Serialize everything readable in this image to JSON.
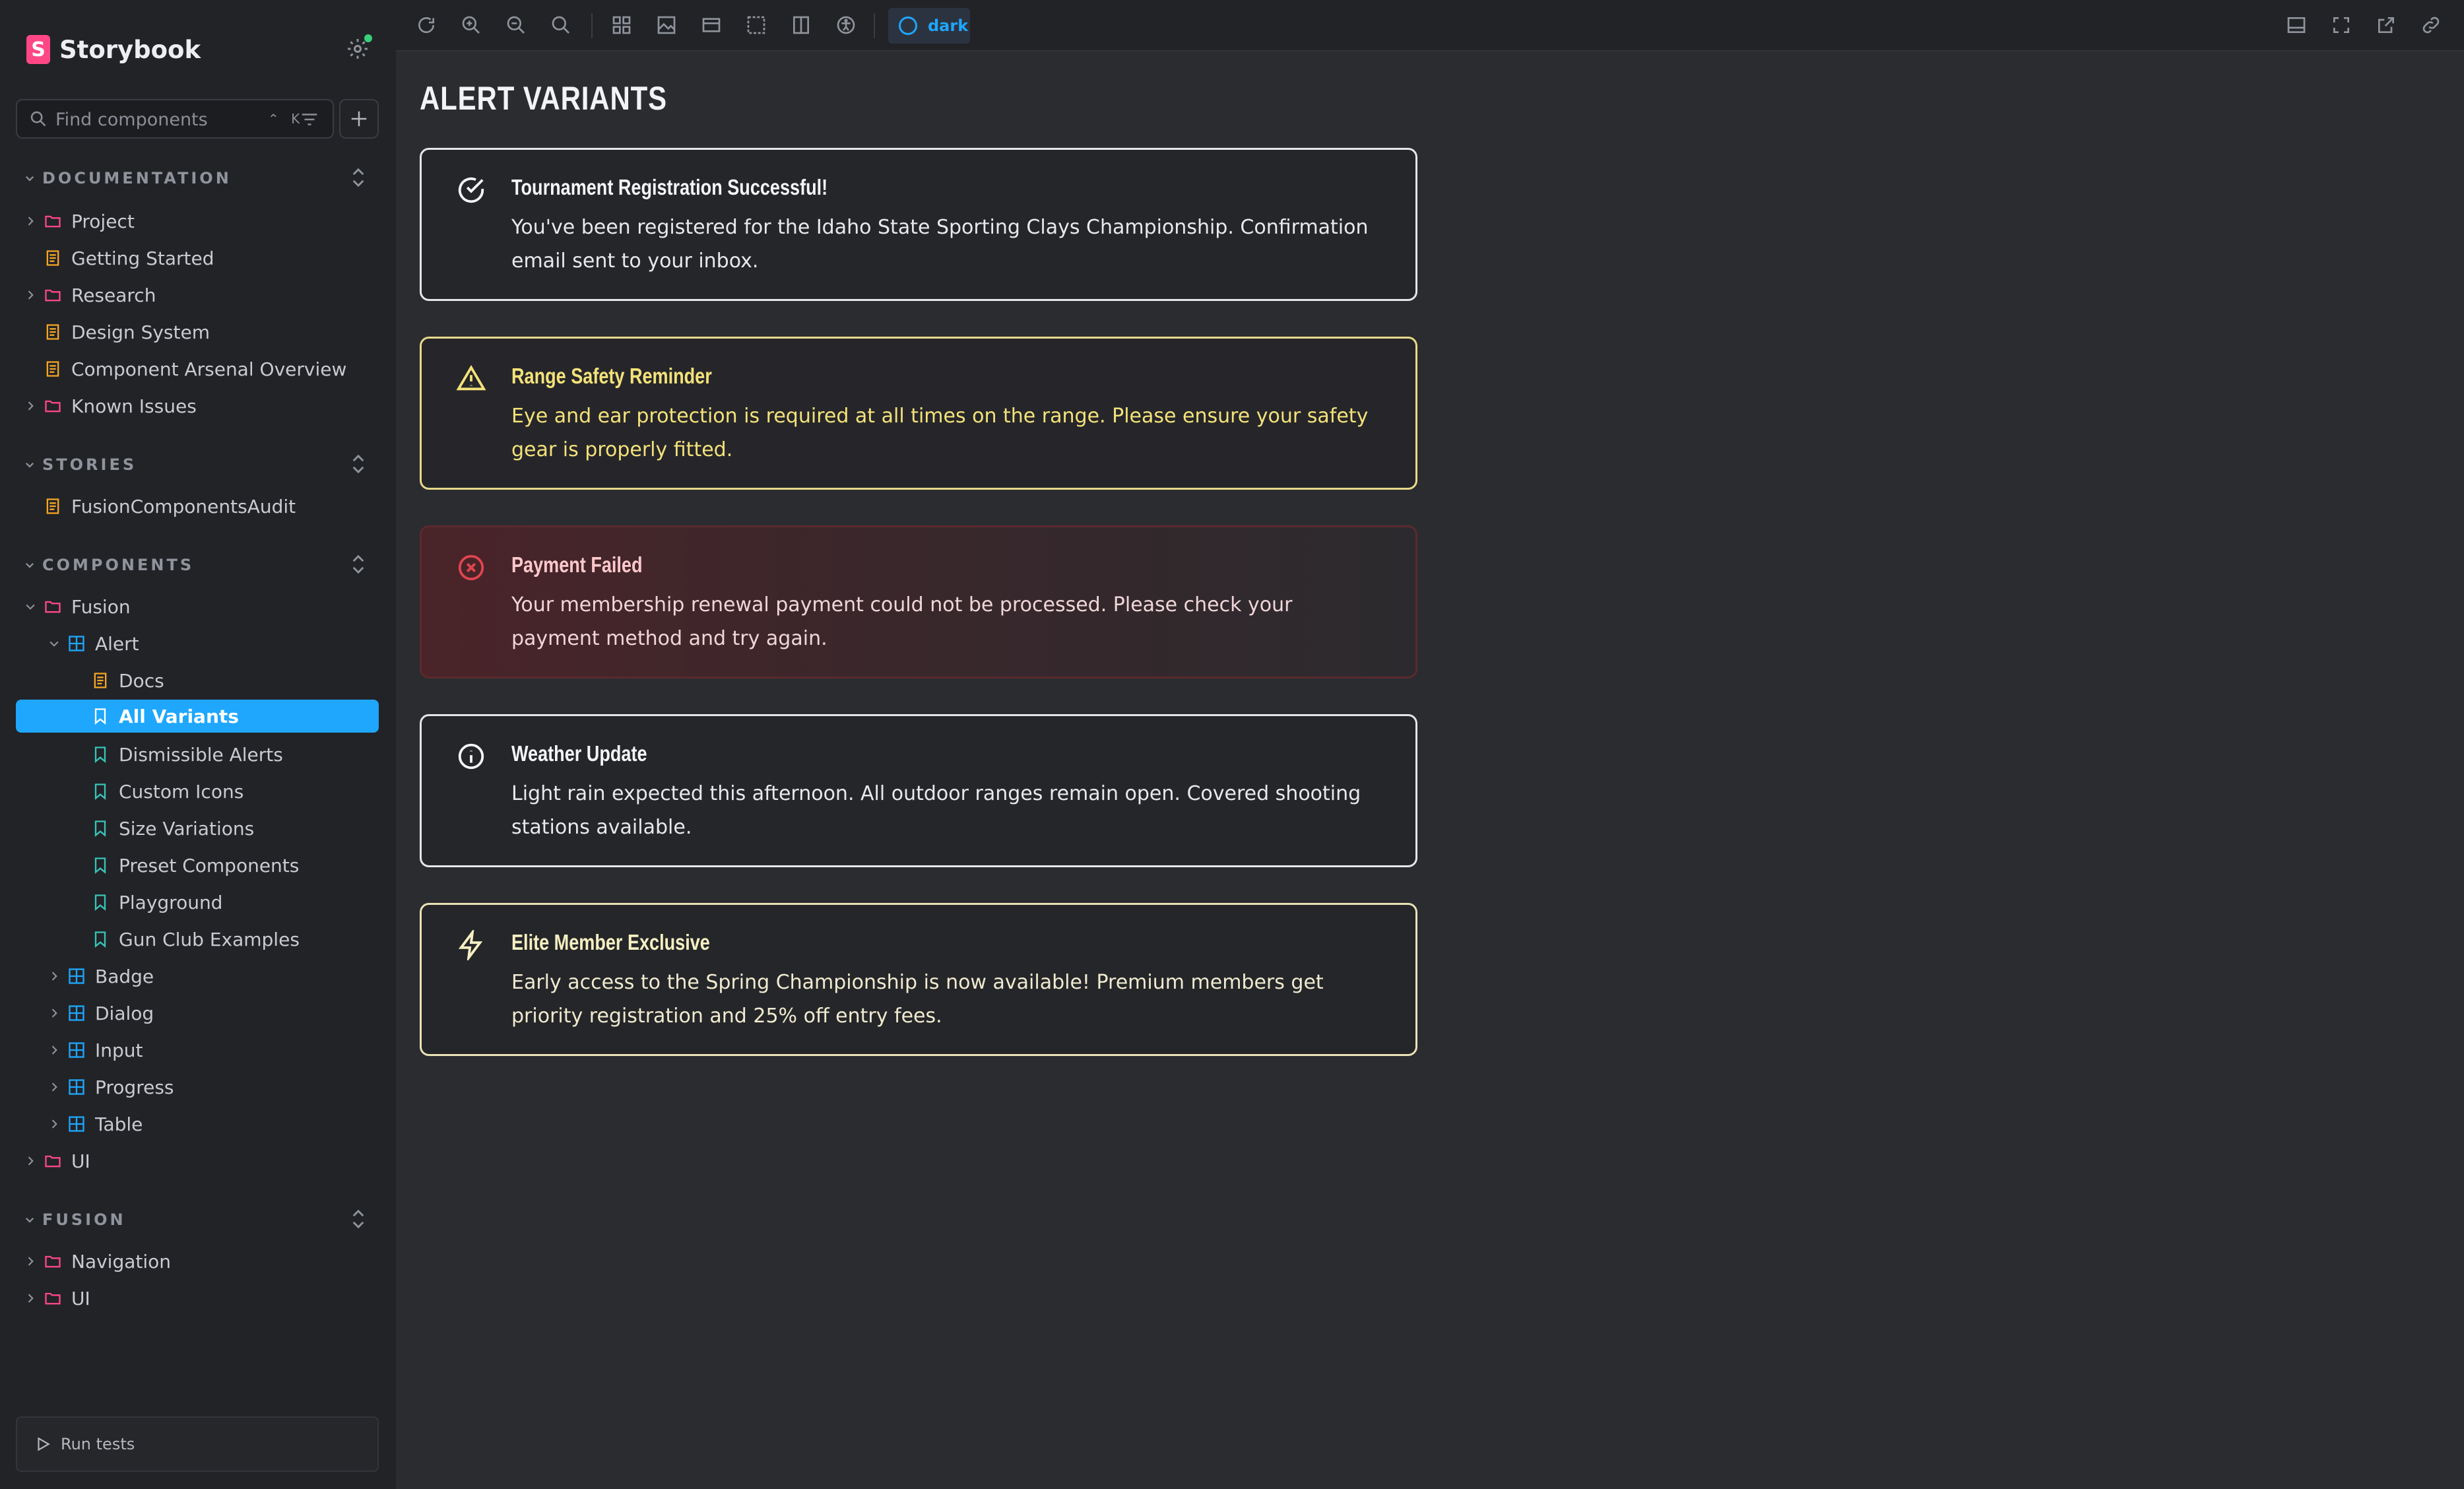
{
  "brand": {
    "name": "Storybook",
    "logo_letter": "S"
  },
  "search": {
    "placeholder": "Find components",
    "shortcut": "⌃ K"
  },
  "sections": [
    {
      "label": "DOCUMENTATION"
    },
    {
      "label": "STORIES"
    },
    {
      "label": "COMPONENTS"
    },
    {
      "label": "FUSION"
    }
  ],
  "tree": {
    "project": "Project",
    "getting_started": "Getting Started",
    "research": "Research",
    "design_system": "Design System",
    "component_arsenal": "Component Arsenal Overview",
    "known_issues": "Known Issues",
    "fusion_audit": "FusionComponentsAudit",
    "fusion": "Fusion",
    "alert": "Alert",
    "docs": "Docs",
    "all_variants": "All Variants",
    "dismissible": "Dismissible Alerts",
    "custom_icons": "Custom Icons",
    "size_variations": "Size Variations",
    "preset_components": "Preset Components",
    "playground": "Playground",
    "gun_club": "Gun Club Examples",
    "badge": "Badge",
    "dialog": "Dialog",
    "input": "Input",
    "progress": "Progress",
    "table": "Table",
    "ui": "UI",
    "navigation": "Navigation",
    "ui2": "UI"
  },
  "run_tests": "Run tests",
  "toolbar": {
    "theme": "dark"
  },
  "main": {
    "title": "ALERT VARIANTS",
    "alerts": [
      {
        "variant": "success",
        "title": "Tournament Registration Successful!",
        "body": "You've been registered for the Idaho State Sporting Clays Championship. Confirmation email sent to your inbox."
      },
      {
        "variant": "warning",
        "title": "Range Safety Reminder",
        "body": "Eye and ear protection is required at all times on the range. Please ensure your safety gear is properly fitted."
      },
      {
        "variant": "error",
        "title": "Payment Failed",
        "body": "Your membership renewal payment could not be processed. Please check your payment method and try again."
      },
      {
        "variant": "info",
        "title": "Weather Update",
        "body": "Light rain expected this afternoon. All outdoor ranges remain open. Covered shooting stations available."
      },
      {
        "variant": "elite",
        "title": "Elite Member Exclusive",
        "body": "Early access to the Spring Championship is now available! Premium members get priority registration and 25% off entry fees."
      }
    ]
  },
  "colors": {
    "accent": "#1ea7fd",
    "brand": "#ff4785",
    "warning": "#f3e27a",
    "error": "#e0454f",
    "folder": "#ff4785",
    "doc": "#f5a623",
    "story": "#37c5b8"
  }
}
